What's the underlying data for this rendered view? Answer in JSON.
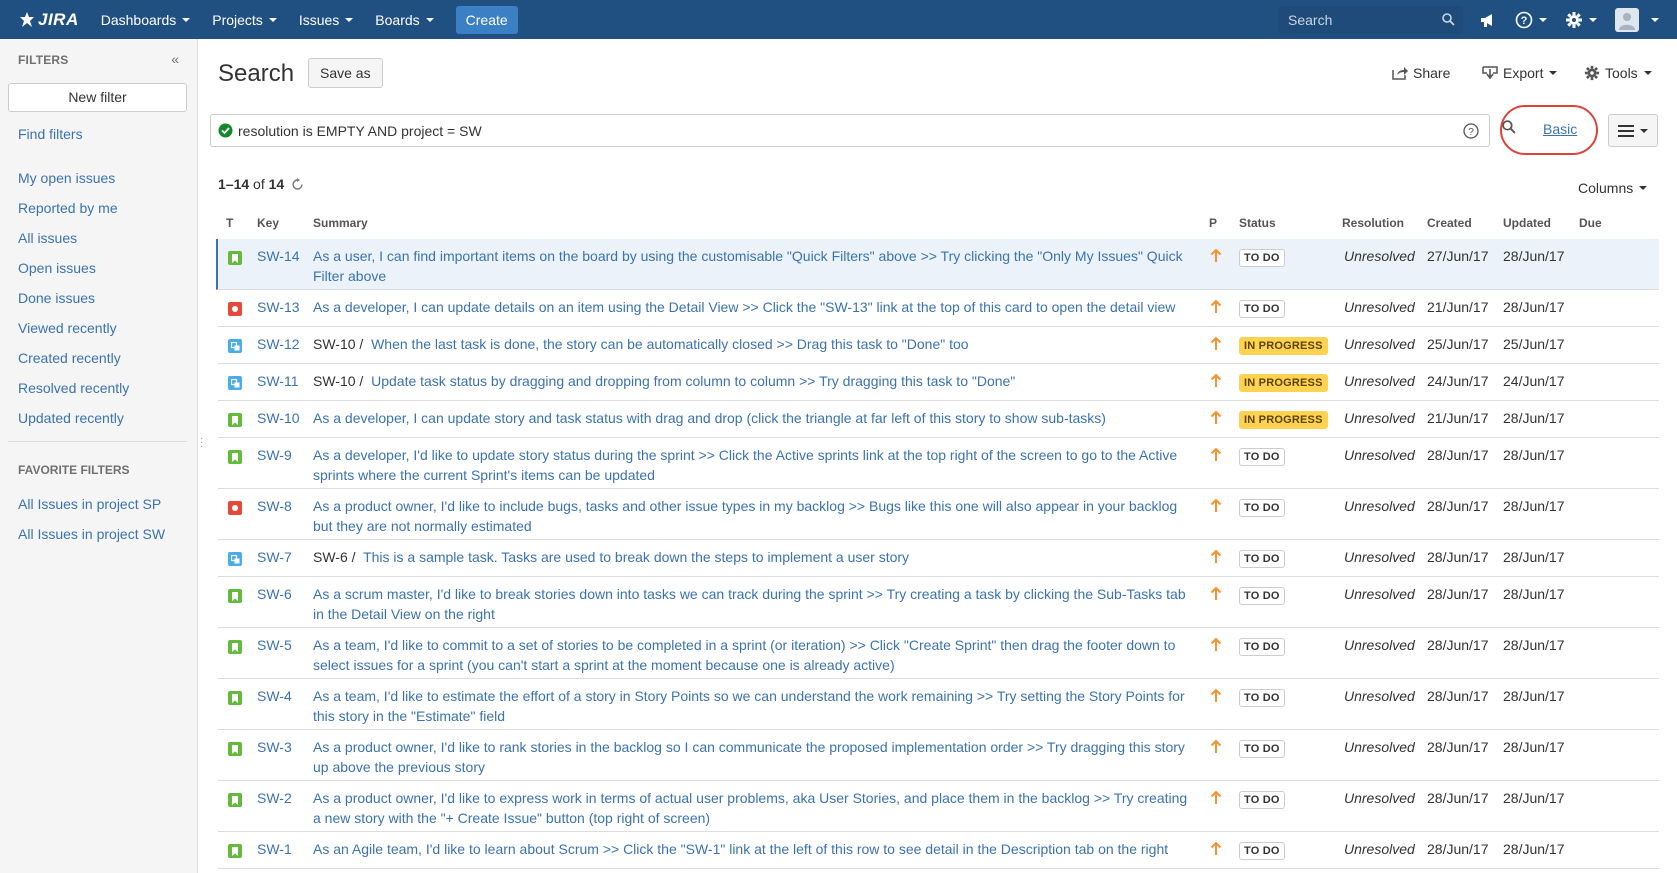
{
  "nav": {
    "logo": "JIRA",
    "items": [
      "Dashboards",
      "Projects",
      "Issues",
      "Boards"
    ],
    "create": "Create",
    "search_placeholder": "Search"
  },
  "sidebar": {
    "heading": "FILTERS",
    "new_filter": "New filter",
    "find_filters": "Find filters",
    "links": [
      "My open issues",
      "Reported by me",
      "All issues",
      "Open issues",
      "Done issues",
      "Viewed recently",
      "Created recently",
      "Resolved recently",
      "Updated recently"
    ],
    "favorites_heading": "FAVORITE FILTERS",
    "favorites": [
      "All Issues in project SP",
      "All Issues in project SW"
    ]
  },
  "main": {
    "title": "Search",
    "save_as": "Save as",
    "share": "Share",
    "export": "Export",
    "tools": "Tools",
    "query": "resolution is EMPTY AND project = SW",
    "basic": "Basic",
    "count_range": "1–14",
    "count_of": "of",
    "count_total": "14",
    "columns": "Columns"
  },
  "table": {
    "headers": [
      "T",
      "Key",
      "Summary",
      "P",
      "Status",
      "Resolution",
      "Created",
      "Updated",
      "Due"
    ],
    "rows": [
      {
        "type": "story",
        "key": "SW-14",
        "parent": "",
        "summary": "As a user, I can find important items on the board by using the customisable \"Quick Filters\" above >> Try clicking the \"Only My Issues\" Quick Filter above",
        "status": "TO DO",
        "resolution": "Unresolved",
        "created": "27/Jun/17",
        "updated": "28/Jun/17"
      },
      {
        "type": "bug",
        "key": "SW-13",
        "parent": "",
        "summary": "As a developer, I can update details on an item using the Detail View >> Click the \"SW-13\" link at the top of this card to open the detail view",
        "status": "TO DO",
        "resolution": "Unresolved",
        "created": "21/Jun/17",
        "updated": "28/Jun/17"
      },
      {
        "type": "task",
        "key": "SW-12",
        "parent": "SW-10 /",
        "summary": "When the last task is done, the story can be automatically closed >> Drag this task to \"Done\" too",
        "status": "IN PROGRESS",
        "resolution": "Unresolved",
        "created": "25/Jun/17",
        "updated": "25/Jun/17"
      },
      {
        "type": "task",
        "key": "SW-11",
        "parent": "SW-10 /",
        "summary": "Update task status by dragging and dropping from column to column >> Try dragging this task to \"Done\"",
        "status": "IN PROGRESS",
        "resolution": "Unresolved",
        "created": "24/Jun/17",
        "updated": "24/Jun/17"
      },
      {
        "type": "story",
        "key": "SW-10",
        "parent": "",
        "summary": "As a developer, I can update story and task status with drag and drop (click the triangle at far left of this story to show sub-tasks)",
        "status": "IN PROGRESS",
        "resolution": "Unresolved",
        "created": "21/Jun/17",
        "updated": "28/Jun/17"
      },
      {
        "type": "story",
        "key": "SW-9",
        "parent": "",
        "summary": "As a developer, I'd like to update story status during the sprint >> Click the Active sprints link at the top right of the screen to go to the Active sprints where the current Sprint's items can be updated",
        "status": "TO DO",
        "resolution": "Unresolved",
        "created": "28/Jun/17",
        "updated": "28/Jun/17"
      },
      {
        "type": "bug",
        "key": "SW-8",
        "parent": "",
        "summary": "As a product owner, I'd like to include bugs, tasks and other issue types in my backlog >> Bugs like this one will also appear in your backlog but they are not normally estimated",
        "status": "TO DO",
        "resolution": "Unresolved",
        "created": "28/Jun/17",
        "updated": "28/Jun/17"
      },
      {
        "type": "task",
        "key": "SW-7",
        "parent": "SW-6 /",
        "summary": "This is a sample task. Tasks are used to break down the steps to implement a user story",
        "status": "TO DO",
        "resolution": "Unresolved",
        "created": "28/Jun/17",
        "updated": "28/Jun/17"
      },
      {
        "type": "story",
        "key": "SW-6",
        "parent": "",
        "summary": "As a scrum master, I'd like to break stories down into tasks we can track during the sprint >> Try creating a task by clicking the Sub-Tasks tab in the Detail View on the right",
        "status": "TO DO",
        "resolution": "Unresolved",
        "created": "28/Jun/17",
        "updated": "28/Jun/17"
      },
      {
        "type": "story",
        "key": "SW-5",
        "parent": "",
        "summary": "As a team, I'd like to commit to a set of stories to be completed in a sprint (or iteration) >> Click \"Create Sprint\" then drag the footer down to select issues for a sprint (you can't start a sprint at the moment because one is already active)",
        "status": "TO DO",
        "resolution": "Unresolved",
        "created": "28/Jun/17",
        "updated": "28/Jun/17"
      },
      {
        "type": "story",
        "key": "SW-4",
        "parent": "",
        "summary": "As a team, I'd like to estimate the effort of a story in Story Points so we can understand the work remaining >> Try setting the Story Points for this story in the \"Estimate\" field",
        "status": "TO DO",
        "resolution": "Unresolved",
        "created": "28/Jun/17",
        "updated": "28/Jun/17"
      },
      {
        "type": "story",
        "key": "SW-3",
        "parent": "",
        "summary": "As a product owner, I'd like to rank stories in the backlog so I can communicate the proposed implementation order >> Try dragging this story up above the previous story",
        "status": "TO DO",
        "resolution": "Unresolved",
        "created": "28/Jun/17",
        "updated": "28/Jun/17"
      },
      {
        "type": "story",
        "key": "SW-2",
        "parent": "",
        "summary": "As a product owner, I'd like to express work in terms of actual user problems, aka User Stories, and place them in the backlog >> Try creating a new story with the \"+ Create Issue\" button (top right of screen)",
        "status": "TO DO",
        "resolution": "Unresolved",
        "created": "28/Jun/17",
        "updated": "28/Jun/17"
      },
      {
        "type": "story",
        "key": "SW-1",
        "parent": "",
        "summary": "As an Agile team, I'd like to learn about Scrum >> Click the \"SW-1\" link at the left of this row to see detail in the Description tab on the right",
        "status": "TO DO",
        "resolution": "Unresolved",
        "created": "28/Jun/17",
        "updated": "28/Jun/17"
      }
    ]
  },
  "colors": {
    "nav_bg": "#205081",
    "link": "#3b73af",
    "story": "#63ba3c",
    "bug": "#e5493a",
    "task": "#4bade8",
    "in_progress": "#ffd351",
    "priority": "#f79232"
  }
}
